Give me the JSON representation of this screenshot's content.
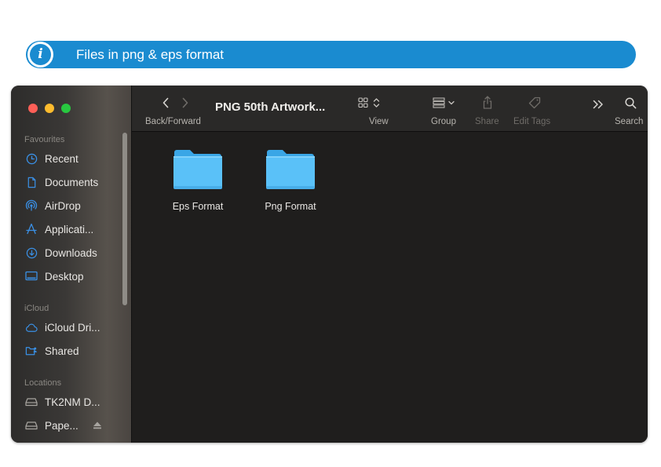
{
  "banner": {
    "icon": "info-icon",
    "icon_glyph": "i",
    "text": "Files in png & eps format",
    "color": "#1a8bd0"
  },
  "window": {
    "title": "PNG 50th Artwork...",
    "toolbar": {
      "back_forward_label": "Back/Forward",
      "view_label": "View",
      "group_label": "Group",
      "share_label": "Share",
      "edit_tags_label": "Edit Tags",
      "search_label": "Search"
    },
    "sidebar": {
      "favourites_label": "Favourites",
      "favourites": [
        {
          "label": "Recent",
          "icon": "clock-icon"
        },
        {
          "label": "Documents",
          "icon": "document-icon"
        },
        {
          "label": "AirDrop",
          "icon": "airdrop-icon"
        },
        {
          "label": "Applicati...",
          "icon": "applications-icon"
        },
        {
          "label": "Downloads",
          "icon": "download-icon"
        },
        {
          "label": "Desktop",
          "icon": "desktop-icon"
        }
      ],
      "icloud_label": "iCloud",
      "icloud": [
        {
          "label": "iCloud Dri...",
          "icon": "cloud-icon"
        },
        {
          "label": "Shared",
          "icon": "shared-folder-icon"
        }
      ],
      "locations_label": "Locations",
      "locations": [
        {
          "label": "TK2NM D...",
          "icon": "drive-icon"
        },
        {
          "label": "Pape...",
          "icon": "drive-icon"
        }
      ]
    },
    "content": {
      "folders": [
        {
          "label": "Eps Format",
          "icon": "folder-icon"
        },
        {
          "label": "Png Format",
          "icon": "folder-icon"
        }
      ]
    },
    "colors": {
      "accent": "#3a90e6",
      "folder": "#5ac1f8"
    }
  }
}
